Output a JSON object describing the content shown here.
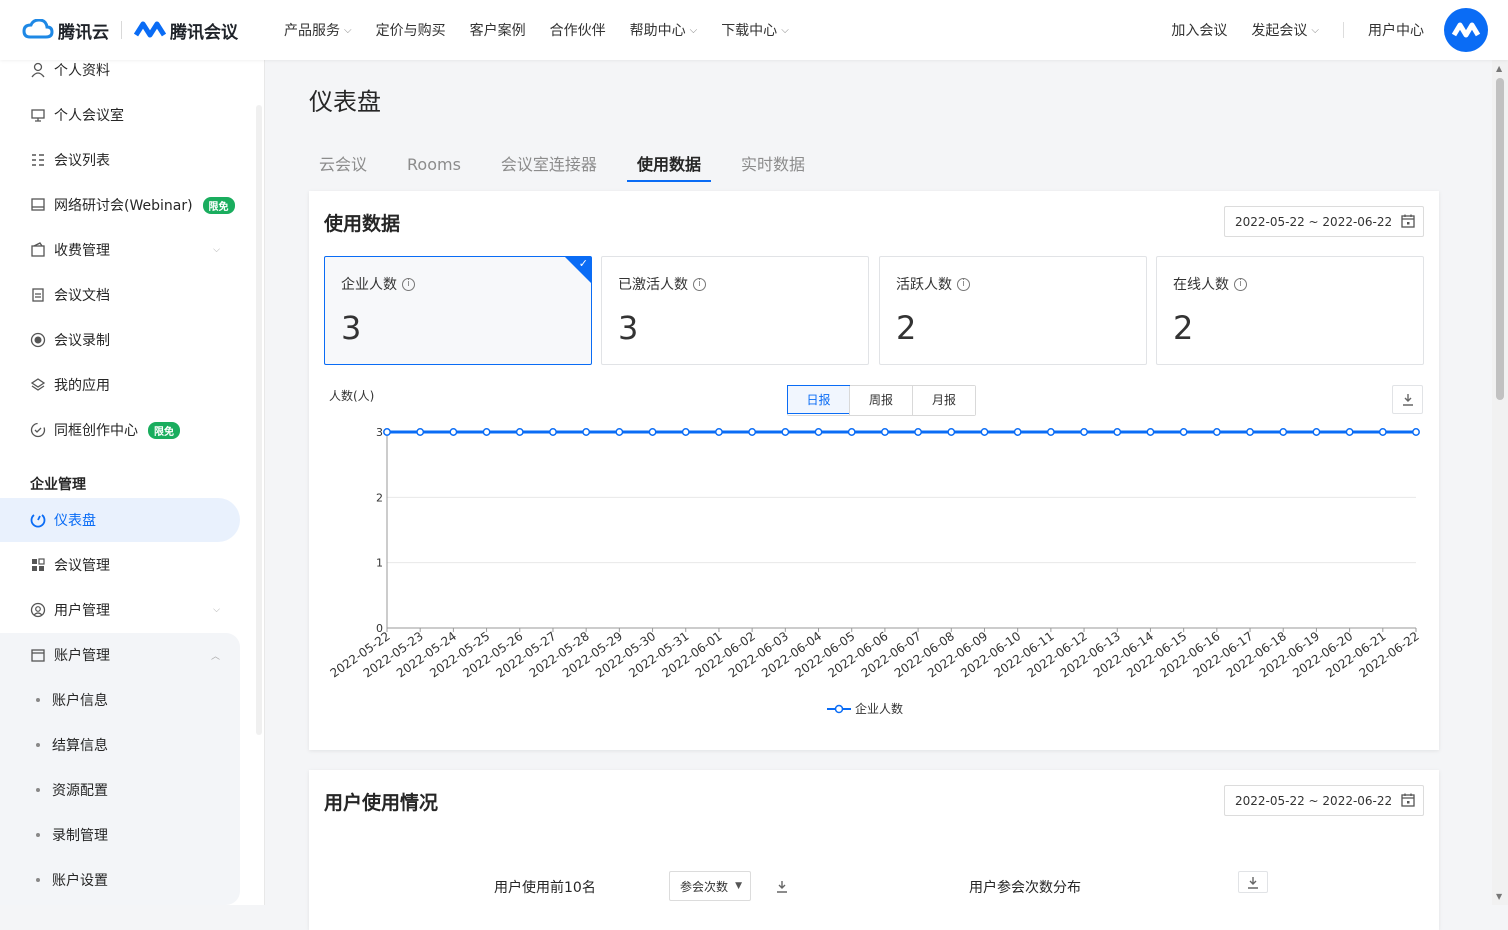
{
  "nav": {
    "brand1": "腾讯云",
    "brand2": "腾讯会议",
    "links": [
      "产品服务",
      "定价与购买",
      "客户案例",
      "合作伙伴",
      "帮助中心",
      "下载中心"
    ],
    "right": [
      "加入会议",
      "发起会议",
      "用户中心"
    ]
  },
  "sidebar": {
    "items": [
      {
        "label": "个人资料",
        "icon": "user-icon"
      },
      {
        "label": "个人会议室",
        "icon": "room-icon"
      },
      {
        "label": "会议列表",
        "icon": "list-icon"
      },
      {
        "label": "网络研讨会(Webinar)",
        "icon": "webinar-icon",
        "badge": "限免"
      },
      {
        "label": "收费管理",
        "icon": "wallet-icon"
      },
      {
        "label": "会议文档",
        "icon": "document-icon"
      },
      {
        "label": "会议录制",
        "icon": "record-icon"
      },
      {
        "label": "我的应用",
        "icon": "layers-icon"
      },
      {
        "label": "同框创作中心",
        "icon": "create-icon",
        "badge": "限免"
      }
    ],
    "group_title": "企业管理",
    "group_items": [
      {
        "label": "仪表盘",
        "icon": "dashboard-icon"
      },
      {
        "label": "会议管理",
        "icon": "grid-icon"
      },
      {
        "label": "用户管理",
        "icon": "users-icon"
      },
      {
        "label": "账户管理",
        "icon": "account-icon"
      }
    ],
    "sub_items": [
      "账户信息",
      "结算信息",
      "资源配置",
      "录制管理",
      "账户设置"
    ]
  },
  "main": {
    "title": "仪表盘",
    "tabs": [
      "云会议",
      "Rooms",
      "会议室连接器",
      "使用数据",
      "实时数据"
    ],
    "active_tab": "使用数据"
  },
  "usage": {
    "title": "使用数据",
    "date_range": "2022-05-22 ~ 2022-06-22",
    "stats": [
      {
        "label": "企业人数",
        "value": "3"
      },
      {
        "label": "已激活人数",
        "value": "3"
      },
      {
        "label": "活跃人数",
        "value": "2"
      },
      {
        "label": "在线人数",
        "value": "2"
      }
    ],
    "segments": [
      "日报",
      "周报",
      "月报"
    ],
    "active_segment": "日报",
    "y_unit": "人数(人)"
  },
  "chart_data": {
    "type": "line",
    "x": [
      "2022-05-22",
      "2022-05-23",
      "2022-05-24",
      "2022-05-25",
      "2022-05-26",
      "2022-05-27",
      "2022-05-28",
      "2022-05-29",
      "2022-05-30",
      "2022-05-31",
      "2022-06-01",
      "2022-06-02",
      "2022-06-03",
      "2022-06-04",
      "2022-06-05",
      "2022-06-06",
      "2022-06-07",
      "2022-06-08",
      "2022-06-09",
      "2022-06-10",
      "2022-06-11",
      "2022-06-12",
      "2022-06-13",
      "2022-06-14",
      "2022-06-15",
      "2022-06-16",
      "2022-06-17",
      "2022-06-18",
      "2022-06-19",
      "2022-06-20",
      "2022-06-21",
      "2022-06-22"
    ],
    "series": [
      {
        "name": "企业人数",
        "values": [
          3,
          3,
          3,
          3,
          3,
          3,
          3,
          3,
          3,
          3,
          3,
          3,
          3,
          3,
          3,
          3,
          3,
          3,
          3,
          3,
          3,
          3,
          3,
          3,
          3,
          3,
          3,
          3,
          3,
          3,
          3,
          3
        ]
      }
    ],
    "ylabel": "人数(人)",
    "ylim": [
      0,
      3
    ],
    "yticks": [
      "0",
      "1",
      "2",
      "3"
    ],
    "grid": true,
    "legend": "bottom-center",
    "color": "#0a6cf5"
  },
  "user_usage": {
    "title": "用户使用情况",
    "date_range": "2022-05-22 ~ 2022-06-22",
    "top10_label": "用户使用前10名",
    "select_value": "参会次数",
    "distribution_label": "用户参会次数分布"
  }
}
